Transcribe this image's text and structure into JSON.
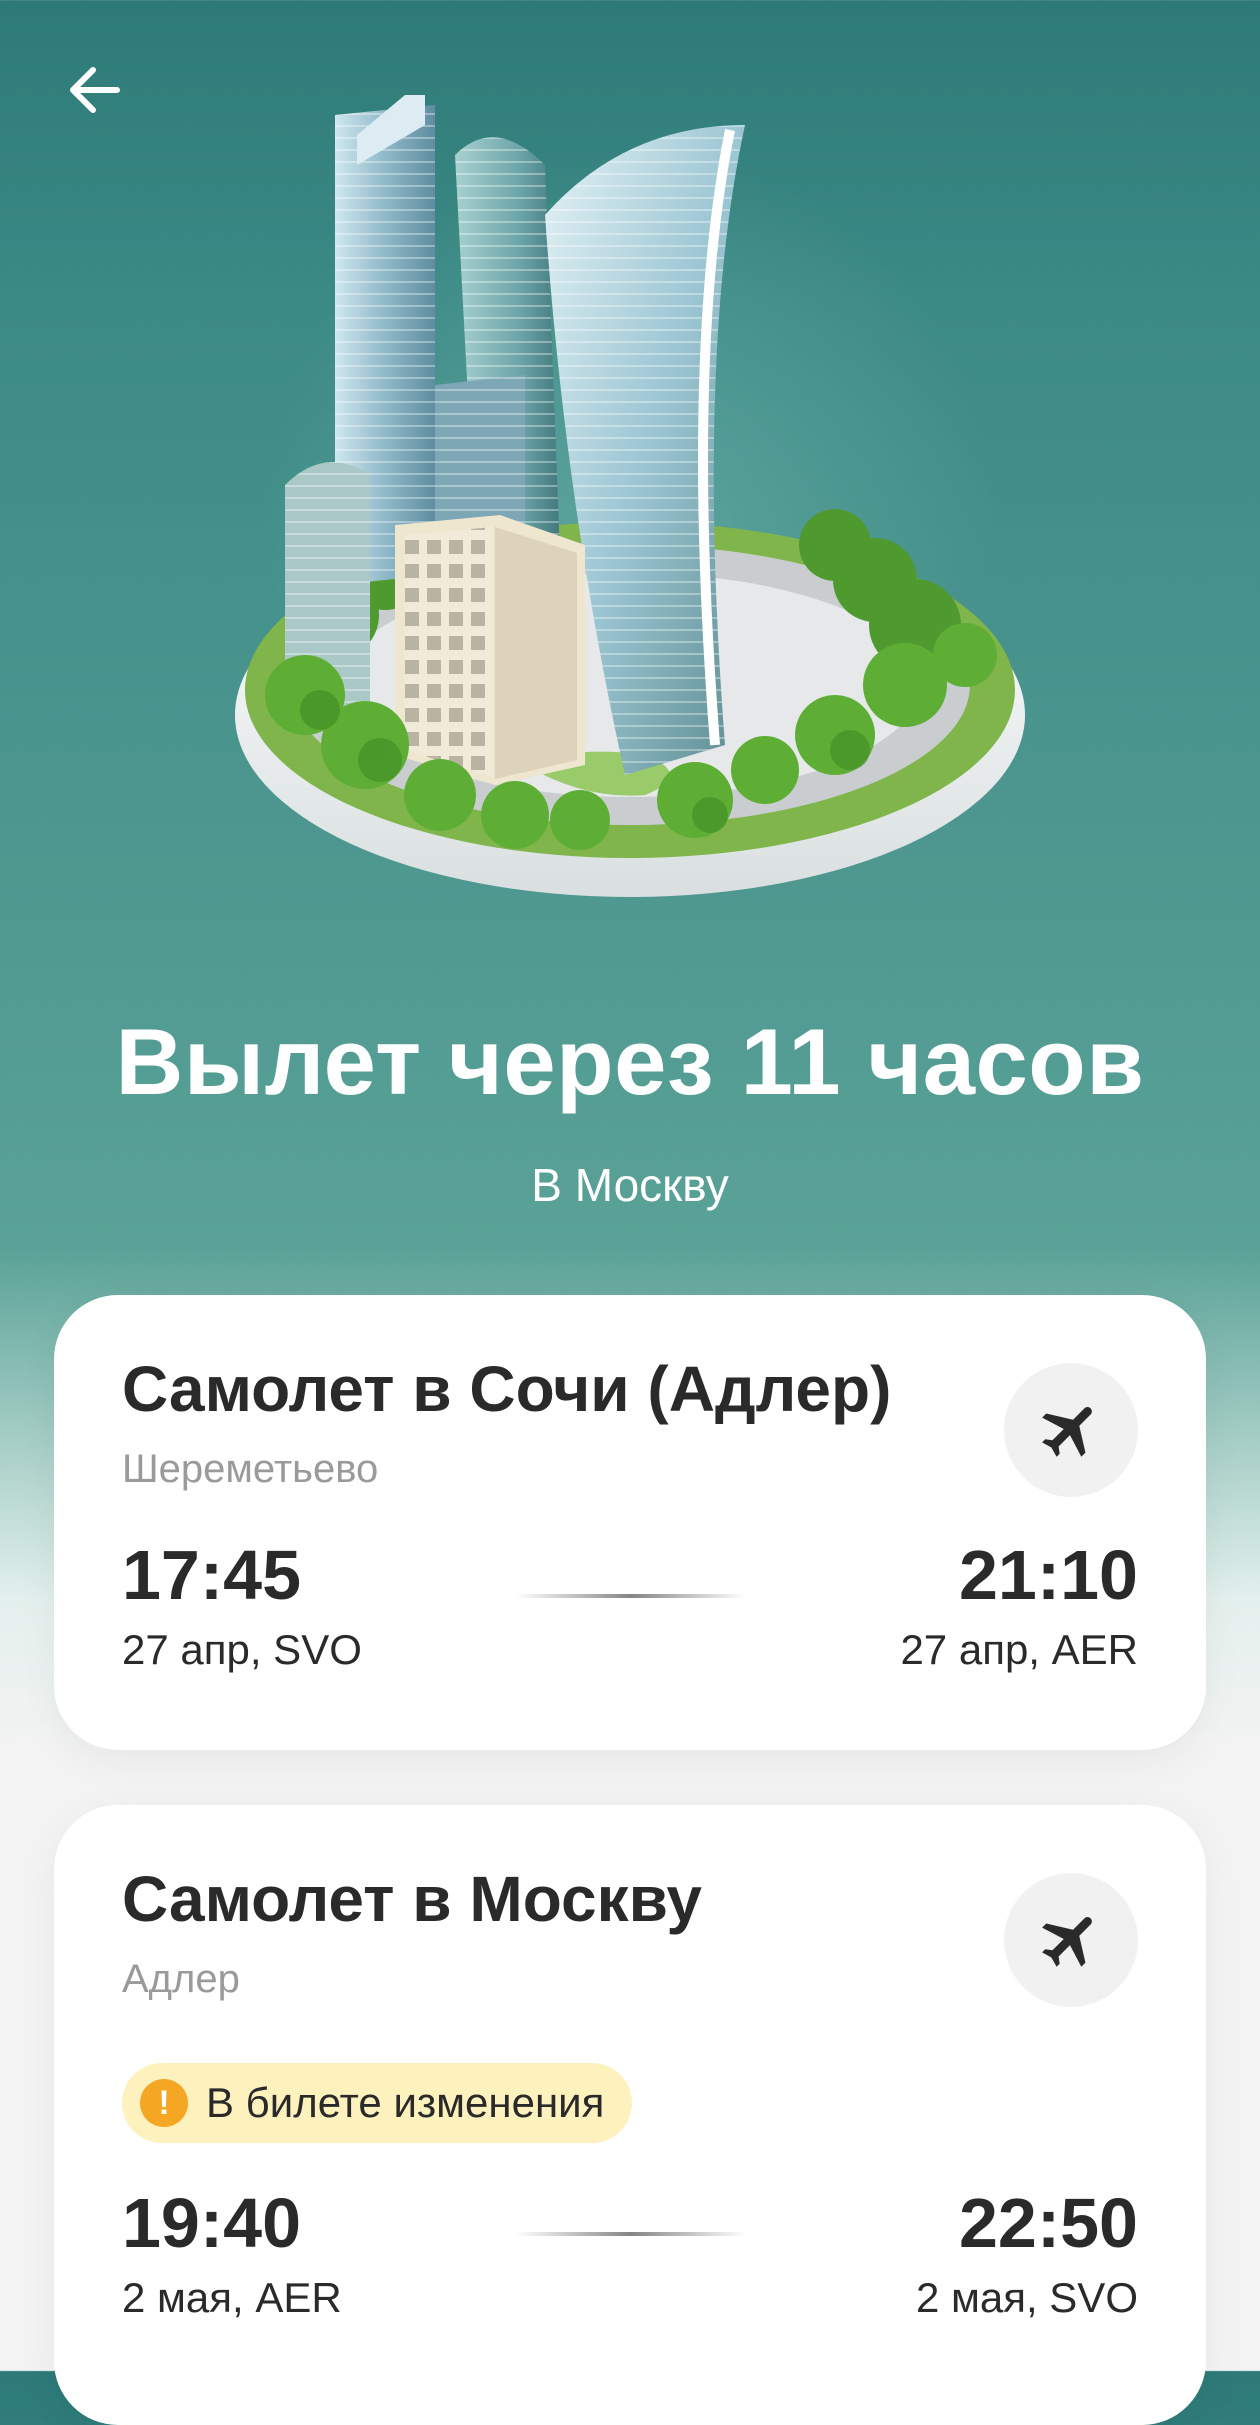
{
  "header": {
    "back_icon": "arrow-left-icon"
  },
  "hero": {
    "illustration": "moscow-city-towers-illustration",
    "title": "Вылет через 11 часов",
    "subtitle": "В Москву"
  },
  "trips": [
    {
      "title": "Самолет в Сочи (Адлер)",
      "airport": "Шереметьево",
      "icon": "airplane-icon",
      "departure_time": "17:45",
      "departure_date": "27 апр, SVO",
      "arrival_time": "21:10",
      "arrival_date": "27 апр, AER"
    },
    {
      "title": "Самолет в Москву",
      "airport": "Адлер",
      "icon": "airplane-icon",
      "badge": "В билете изменения",
      "badge_icon": "!",
      "departure_time": "19:40",
      "departure_date": "2 мая, AER",
      "arrival_time": "22:50",
      "arrival_date": "2 мая, SVO"
    }
  ],
  "colors": {
    "hero_background": "#2d7a78",
    "badge_background": "#fdf1bd",
    "badge_icon": "#f5a623",
    "text": "#2a2a2a",
    "muted": "#9a9a9a"
  }
}
